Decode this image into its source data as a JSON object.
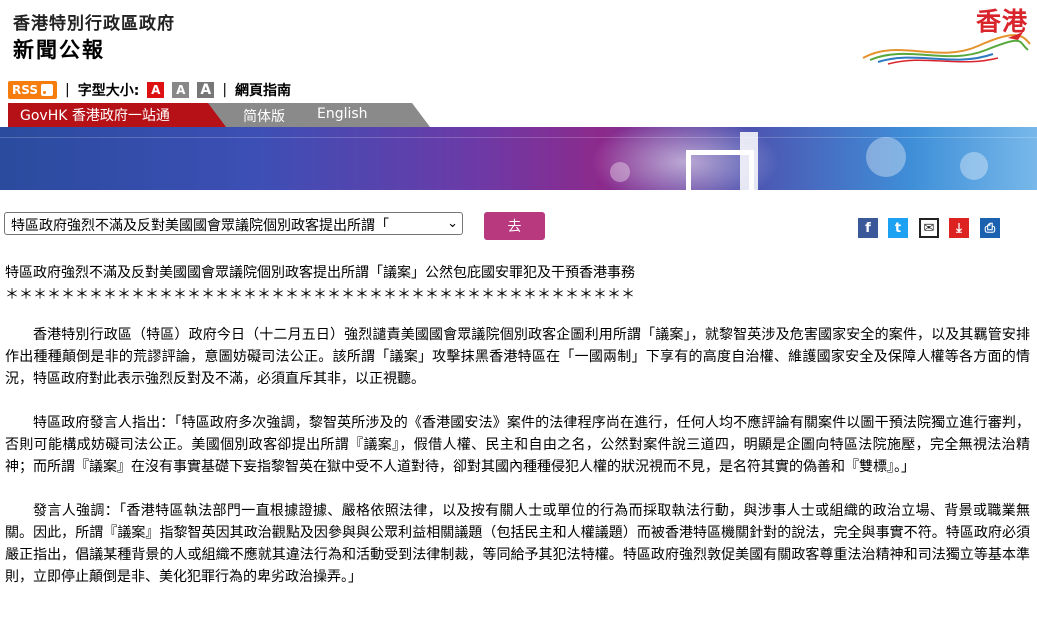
{
  "header": {
    "site_line1": "香港特別行政區政府",
    "site_line2": "新聞公報",
    "brand_logo": "香港"
  },
  "toolbar": {
    "rss": "RSS",
    "font_size_label": "字型大小:",
    "font_sizes": [
      "A",
      "A",
      "A"
    ],
    "page_guide": "網頁指南"
  },
  "nav": {
    "govhk": "GovHK 香港政府一站通",
    "simplified": "简体版",
    "english": "English"
  },
  "selector": {
    "selected": "特區政府強烈不滿及反對美國國會眾議院個別政客提出所謂「",
    "go": "去"
  },
  "share_icons": [
    "facebook-icon",
    "twitter-icon",
    "mail-icon",
    "save-icon",
    "print-icon"
  ],
  "article": {
    "title": "特區政府強烈不滿及反對美國國會眾議院個別政客提出所謂「議案」公然包庇國安罪犯及干預香港事務",
    "stars": "＊＊＊＊＊＊＊＊＊＊＊＊＊＊＊＊＊＊＊＊＊＊＊＊＊＊＊＊＊＊＊＊＊＊＊＊＊＊＊＊＊＊＊＊＊",
    "paragraphs": [
      "香港特別行政區（特區）政府今日（十二月五日）強烈譴責美國國會眾議院個別政客企圖利用所謂「議案」，就黎智英涉及危害國家安全的案件，以及其羈管安排作出種種顛倒是非的荒謬評論，意圖妨礙司法公正。該所謂「議案」攻擊抹黑香港特區在「一國兩制」下享有的高度自治權、維護國家安全及保障人權等各方面的情況，特區政府對此表示強烈反對及不滿，必須直斥其非，以正視聽。",
      "特區政府發言人指出：「特區政府多次強調，黎智英所涉及的《香港國安法》案件的法律程序尚在進行，任何人均不應評論有關案件以圖干預法院獨立進行審判，否則可能構成妨礙司法公正。美國個別政客卻提出所謂『議案』，假借人權、民主和自由之名，公然對案件說三道四，明顯是企圖向特區法院施壓，完全無視法治精神；而所謂『議案』在沒有事實基礎下妄指黎智英在獄中受不人道對待，卻對其國內種種侵犯人權的狀況視而不見，是名符其實的偽善和『雙標』。」",
      "發言人強調：「香港特區執法部門一直根據證據、嚴格依照法律，以及按有關人士或單位的行為而採取執法行動，與涉事人士或組織的政治立場、背景或職業無關。因此，所謂『議案』指黎智英因其政治觀點及因參與與公眾利益相關議題（包括民主和人權議題）而被香港特區機關針對的說法，完全與事實不符。特區政府必須嚴正指出，倡議某種背景的人或組織不應就其違法行為和活動受到法律制裁，等同給予其犯法特權。特區政府強烈敦促美國有關政客尊重法治精神和司法獨立等基本準則，立即停止顛倒是非、美化犯罪行為的卑劣政治操弄。」"
    ]
  },
  "colors": {
    "go_button": "#b8397e",
    "govhk_tab": "#b51116",
    "brand_red": "#d9242c"
  }
}
